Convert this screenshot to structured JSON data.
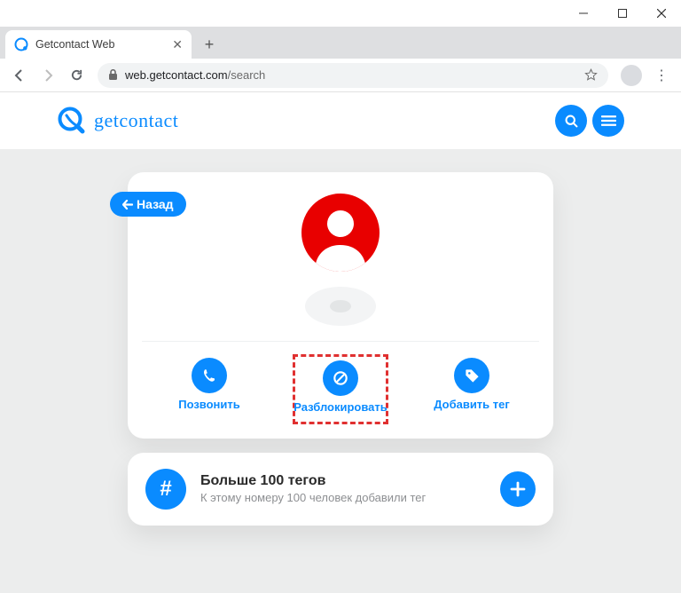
{
  "window": {
    "tab_title": "Getcontact Web"
  },
  "address": {
    "host": "web.getcontact.com",
    "path": "/search"
  },
  "brand": {
    "name": "getcontact"
  },
  "profile": {
    "back_label": "Назад",
    "actions": {
      "call": "Позвонить",
      "unblock": "Разблокировать",
      "add_tag": "Добавить тег"
    }
  },
  "tags_card": {
    "title": "Больше 100 тегов",
    "subtitle": "К этому номеру 100 человек добавили тег"
  }
}
